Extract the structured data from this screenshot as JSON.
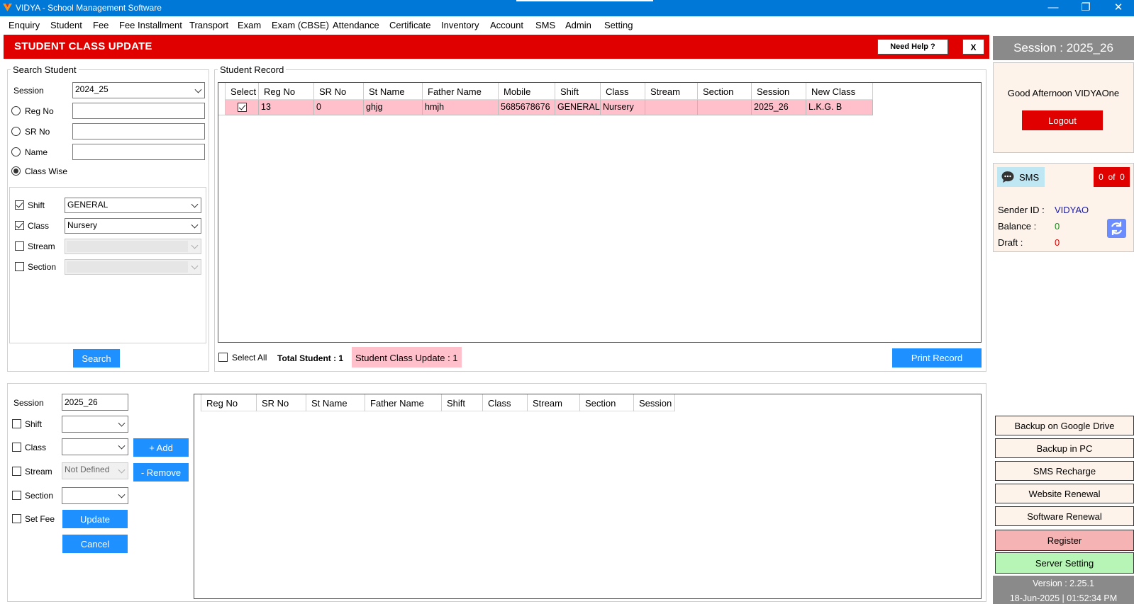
{
  "window": {
    "title": "VIDYA - School Management Software",
    "minimize": "—",
    "restore": "❐",
    "close": "✕"
  },
  "menu": [
    "Enquiry",
    "Student",
    "Fee",
    "Fee Installment",
    "Transport",
    "Exam",
    "Exam (CBSE)",
    "Attendance",
    "Certificate",
    "Inventory",
    "Account",
    "SMS",
    "Admin",
    "Setting"
  ],
  "header": {
    "title": "STUDENT CLASS UPDATE",
    "help": "Need Help ?",
    "close": "X"
  },
  "search": {
    "legend": "Search Student",
    "session_label": "Session",
    "session_value": "2024_25",
    "regno_label": "Reg No",
    "srno_label": "SR No",
    "name_label": "Name",
    "classwise_label": "Class Wise",
    "selected_mode": "Class Wise",
    "shift_label": "Shift",
    "shift_value": "GENERAL",
    "class_label": "Class",
    "class_value": "Nursery",
    "stream_label": "Stream",
    "section_label": "Section",
    "search_button": "Search"
  },
  "record": {
    "legend": "Student Record",
    "columns": [
      "Select",
      "Reg No",
      "SR No",
      "St Name",
      "Father Name",
      "Mobile",
      "Shift",
      "Class",
      "Stream",
      "Section",
      "Session",
      "New Class"
    ],
    "rows": [
      {
        "selected": true,
        "cells": [
          "13",
          "0",
          "ghjg",
          "hmjh",
          "5685678676",
          "GENERAL",
          "Nursery",
          "",
          "",
          "2025_26",
          "L.K.G.  B"
        ]
      }
    ],
    "select_all": "Select All",
    "total_label": "Total Student  :  1",
    "update_label": "Student Class Update : 1",
    "print_button": "Print Record"
  },
  "update": {
    "session_label": "Session",
    "session_value": "2025_26",
    "shift_label": "Shift",
    "class_label": "Class",
    "stream_label": "Stream",
    "stream_value": "Not Defined",
    "section_label": "Section",
    "setfee_label": "Set Fee",
    "add_button": "+ Add",
    "remove_button": "- Remove",
    "update_button": "Update",
    "cancel_button": "Cancel",
    "columns": [
      "Reg No",
      "SR No",
      "St Name",
      "Father Name",
      "Shift",
      "Class",
      "Stream",
      "Section",
      "Session"
    ]
  },
  "sidebar": {
    "session": "Session : 2025_26",
    "greeting": "Good Afternoon VIDYAOne",
    "logout": "Logout",
    "sms_label": "SMS",
    "sms_count": "0  of  0",
    "sender_label": "Sender ID :",
    "sender_value": "VIDYAO",
    "balance_label": "Balance :",
    "balance_value": "0",
    "draft_label": "Draft :",
    "draft_value": "0",
    "buttons": [
      "Backup on Google Drive",
      "Backup in PC",
      "SMS Recharge",
      "Website Renewal",
      "Software Renewal",
      "Register",
      "Server Setting"
    ],
    "version": "Version : 2.25.1",
    "datetime": "18-Jun-2025 | 01:52:34 PM"
  }
}
